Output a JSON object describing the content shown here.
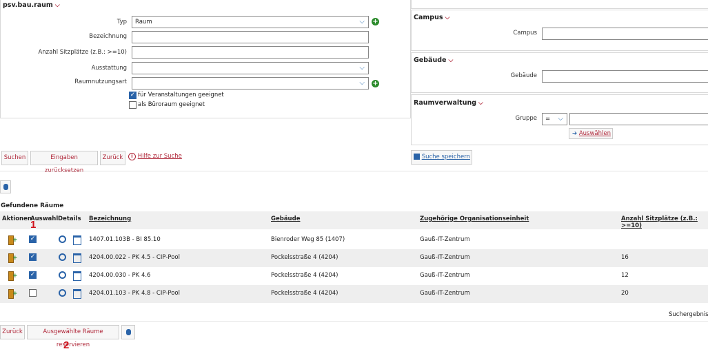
{
  "main_panel": {
    "title": "psv.bau.raum",
    "fields": {
      "typ": {
        "label": "Typ",
        "value": "Raum"
      },
      "bezeichnung": {
        "label": "Bezeichnung",
        "value": ""
      },
      "sitzplaetze": {
        "label": "Anzahl Sitzplätze (z.B.: >=10)",
        "value": ""
      },
      "ausstattung": {
        "label": "Ausstattung",
        "value": ""
      },
      "raumnutzungsart": {
        "label": "Raumnutzungsart",
        "value": ""
      }
    },
    "checkboxes": [
      {
        "label": "für Veranstaltungen geeignet",
        "checked": true
      },
      {
        "label": "als Büroraum geeignet",
        "checked": false
      }
    ]
  },
  "right_panels": {
    "campus": {
      "title": "Campus",
      "label": "Campus",
      "value": ""
    },
    "gebaeude": {
      "title": "Gebäude",
      "label": "Gebäude",
      "value": ""
    },
    "raumverwaltung": {
      "title": "Raumverwaltung",
      "label": "Gruppe",
      "operator": "=",
      "value": "",
      "select_label": "Auswählen"
    }
  },
  "search_buttons": {
    "search": "Suchen",
    "reset": "Eingaben zurücksetzen",
    "back": "Zurück",
    "help": "Hilfe zur Suche",
    "save_search": "Suche speichern"
  },
  "results": {
    "title": "Gefundene Räume",
    "columns": {
      "aktionen": "Aktionen",
      "auswahl": "Auswahl",
      "details": "Details",
      "bezeichnung": "Bezeichnung",
      "gebaeude": "Gebäude",
      "org": "Zugehörige Organisationseinheit",
      "sitze": "Anzahl Sitzplätze (z.B.: >=10)"
    },
    "rows": [
      {
        "checked": true,
        "bezeichnung": "1407.01.103B - BI 85.10",
        "gebaeude": "Bienroder Weg 85 (1407)",
        "org": "Gauß-IT-Zentrum",
        "sitze": ""
      },
      {
        "checked": true,
        "bezeichnung": "4204.00.022 - PK 4.5 - CIP-Pool",
        "gebaeude": "Pockelsstraße 4 (4204)",
        "org": "Gauß-IT-Zentrum",
        "sitze": "16"
      },
      {
        "checked": true,
        "bezeichnung": "4204.00.030 - PK 4.6",
        "gebaeude": "Pockelsstraße 4 (4204)",
        "org": "Gauß-IT-Zentrum",
        "sitze": "12"
      },
      {
        "checked": false,
        "bezeichnung": "4204.01.103 - PK 4.8 - CIP-Pool",
        "gebaeude": "Pockelsstraße 4 (4204)",
        "org": "Gauß-IT-Zentrum",
        "sitze": "20"
      }
    ],
    "summary": "Suchergebnis:"
  },
  "bottom_buttons": {
    "back": "Zurück",
    "reserve": "Ausgewählte Räume reservieren"
  },
  "annotations": {
    "one": "1",
    "two": "2"
  }
}
